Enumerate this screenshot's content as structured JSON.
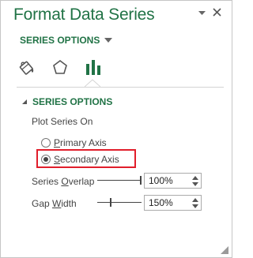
{
  "pane": {
    "title": "Format Data Series",
    "options_dropdown_label": "SERIES OPTIONS"
  },
  "tabs": [
    {
      "icon": "paint-bucket-icon"
    },
    {
      "icon": "pentagon-icon"
    },
    {
      "icon": "bar-chart-icon",
      "active": true
    }
  ],
  "series_options": {
    "section_title": "SERIES OPTIONS",
    "plot_series_on": {
      "label": "Plot Series On",
      "options": [
        {
          "label": "Primary Axis",
          "selected": false
        },
        {
          "label": "Secondary Axis",
          "selected": true
        }
      ]
    },
    "series_overlap": {
      "label": "Series Overlap",
      "value": "100%",
      "slider_fraction": 1.0
    },
    "gap_width": {
      "label": "Gap Width",
      "value": "150%"
    }
  },
  "colors": {
    "accent": "#217346",
    "highlight": "#e11e2b"
  }
}
